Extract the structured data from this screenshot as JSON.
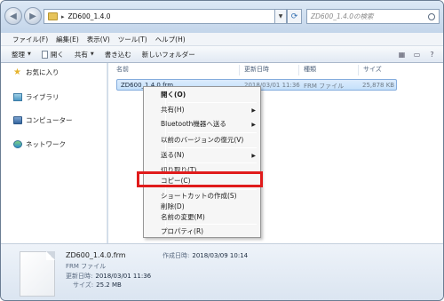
{
  "address": {
    "path": "ZD600_1.4.0",
    "search_placeholder": "ZD600_1.4.0の検索"
  },
  "menu": [
    "ファイル(F)",
    "編集(E)",
    "表示(V)",
    "ツール(T)",
    "ヘルプ(H)"
  ],
  "toolbar": {
    "organize": "整理",
    "open": "開く",
    "share": "共有",
    "burn": "書き込む",
    "new_folder": "新しいフォルダー"
  },
  "nav": {
    "favorites": "お気に入り",
    "libraries": "ライブラリ",
    "computer": "コンピューター",
    "network": "ネットワーク"
  },
  "columns": {
    "name": "名前",
    "date": "更新日時",
    "type": "種類",
    "size": "サイズ"
  },
  "file": {
    "name": "ZD600_1.4.0.frm",
    "date": "2018/03/01 11:36",
    "type": "FRM ファイル",
    "size": "25,878 KB"
  },
  "context_menu": {
    "open": "開く(O)",
    "share": "共有(H)",
    "bluetooth": "Bluetooth機器へ送る",
    "restore": "以前のバージョンの復元(V)",
    "send_to": "送る(N)",
    "cut": "切り取り(T)",
    "copy": "コピー(C)",
    "shortcut": "ショートカットの作成(S)",
    "delete": "削除(D)",
    "rename": "名前の変更(M)",
    "properties": "プロパティ(R)"
  },
  "details": {
    "name": "ZD600_1.4.0.frm",
    "type": "FRM ファイル",
    "modified_label": "更新日時:",
    "modified": "2018/03/01 11:36",
    "size_label": "サイズ:",
    "size": "25.2 MB",
    "created_label": "作成日時:",
    "created": "2018/03/09 10:14"
  },
  "colors": {
    "highlight_border": "#e01b1b",
    "selection": "#cce4fb"
  }
}
